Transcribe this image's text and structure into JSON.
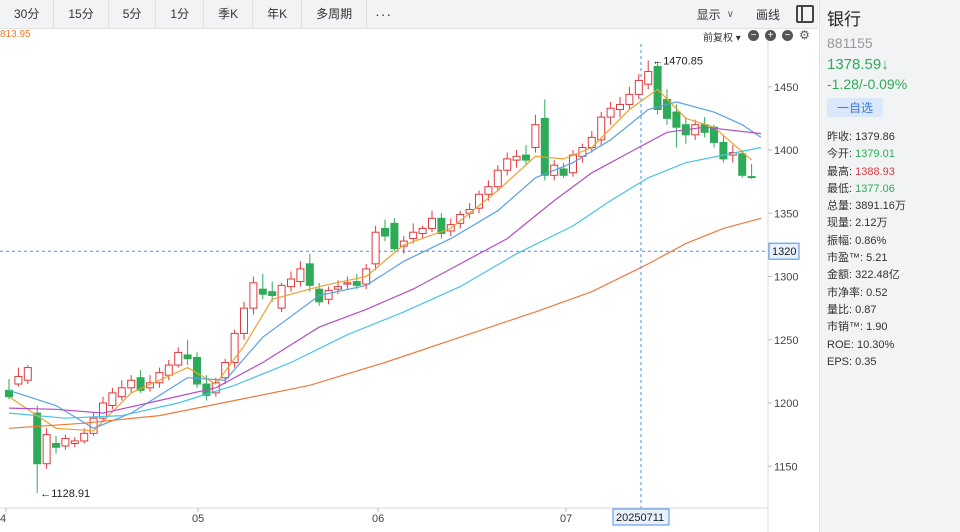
{
  "toolbar": {
    "periods": [
      "30分",
      "15分",
      "5分",
      "1分",
      "季K",
      "年K",
      "多周期"
    ],
    "more_label": "···",
    "display_label": "显示",
    "draw_label": "画线"
  },
  "subbar": {
    "ma_value": "813.95",
    "adjust_label": "前复权"
  },
  "stock": {
    "name": "银行",
    "code": "881155",
    "price": "1378.59↓",
    "change": "-1.28/-0.09%",
    "watch_label": "一自选"
  },
  "quotes": [
    {
      "label": "昨收:",
      "value": "1379.86",
      "tone": "normal"
    },
    {
      "label": "今开:",
      "value": "1379.01",
      "tone": "green"
    },
    {
      "label": "最高:",
      "value": "1388.93",
      "tone": "red"
    },
    {
      "label": "最低:",
      "value": "1377.06",
      "tone": "green"
    },
    {
      "label": "总量:",
      "value": "3891.16万",
      "tone": "normal"
    },
    {
      "label": "现量:",
      "value": "2.12万",
      "tone": "normal"
    },
    {
      "label": "振幅:",
      "value": "0.86%",
      "tone": "normal"
    },
    {
      "label": "市盈™:",
      "value": "5.21",
      "tone": "normal"
    },
    {
      "label": "金额:",
      "value": "322.48亿",
      "tone": "normal"
    },
    {
      "label": "市净率:",
      "value": "0.52",
      "tone": "normal"
    },
    {
      "label": "量比:",
      "value": "0.87",
      "tone": "normal"
    },
    {
      "label": "市销™:",
      "value": "1.90",
      "tone": "normal"
    },
    {
      "label": "ROE:",
      "value": "10.30%",
      "tone": "normal"
    },
    {
      "label": "EPS:",
      "value": "0.35",
      "tone": "normal"
    }
  ],
  "colors": {
    "up": "#e0393e",
    "down": "#2eab58",
    "ma5": "#f0a030",
    "ma10": "#5aa0e6",
    "ma20": "#b44fc2",
    "ma30": "#48c4e6",
    "ma60": "#f07a3e"
  },
  "chart_data": {
    "type": "candlestick",
    "y_ticks": [
      1150,
      1200,
      1250,
      1300,
      1350,
      1400,
      1450
    ],
    "x_ticks": [
      "4",
      "05",
      "06",
      "07"
    ],
    "crosshair": {
      "price": "1320",
      "date": "20250711"
    },
    "annotations": [
      {
        "text": "←1470.85",
        "value": 1470.85
      },
      {
        "text": "←1128.91",
        "value": 1128.91
      }
    ],
    "candles": [
      {
        "o": 1210,
        "h": 1219,
        "c": 1205,
        "l": 1203
      },
      {
        "o": 1215,
        "h": 1228,
        "c": 1221,
        "l": 1213
      },
      {
        "o": 1218,
        "h": 1230,
        "c": 1228,
        "l": 1215
      },
      {
        "o": 1192,
        "h": 1198,
        "c": 1152,
        "l": 1128.91
      },
      {
        "o": 1152,
        "h": 1180,
        "c": 1175,
        "l": 1148
      },
      {
        "o": 1168,
        "h": 1174,
        "c": 1165,
        "l": 1160
      },
      {
        "o": 1166,
        "h": 1175,
        "c": 1172,
        "l": 1163
      },
      {
        "o": 1168,
        "h": 1173,
        "c": 1170,
        "l": 1165
      },
      {
        "o": 1170,
        "h": 1180,
        "c": 1176,
        "l": 1168
      },
      {
        "o": 1176,
        "h": 1192,
        "c": 1188,
        "l": 1174
      },
      {
        "o": 1188,
        "h": 1205,
        "c": 1200,
        "l": 1186
      },
      {
        "o": 1198,
        "h": 1212,
        "c": 1208,
        "l": 1195
      },
      {
        "o": 1205,
        "h": 1218,
        "c": 1212,
        "l": 1202
      },
      {
        "o": 1212,
        "h": 1222,
        "c": 1218,
        "l": 1208
      },
      {
        "o": 1220,
        "h": 1226,
        "c": 1210,
        "l": 1208
      },
      {
        "o": 1212,
        "h": 1222,
        "c": 1216,
        "l": 1209
      },
      {
        "o": 1216,
        "h": 1228,
        "c": 1224,
        "l": 1212
      },
      {
        "o": 1222,
        "h": 1234,
        "c": 1230,
        "l": 1218
      },
      {
        "o": 1230,
        "h": 1244,
        "c": 1240,
        "l": 1228
      },
      {
        "o": 1238,
        "h": 1250,
        "c": 1235,
        "l": 1230
      },
      {
        "o": 1236,
        "h": 1240,
        "c": 1215,
        "l": 1212
      },
      {
        "o": 1215,
        "h": 1222,
        "c": 1206,
        "l": 1202
      },
      {
        "o": 1208,
        "h": 1220,
        "c": 1216,
        "l": 1205
      },
      {
        "o": 1220,
        "h": 1235,
        "c": 1232,
        "l": 1215
      },
      {
        "o": 1232,
        "h": 1258,
        "c": 1255,
        "l": 1228
      },
      {
        "o": 1255,
        "h": 1280,
        "c": 1275,
        "l": 1250
      },
      {
        "o": 1275,
        "h": 1300,
        "c": 1295,
        "l": 1270
      },
      {
        "o": 1290,
        "h": 1302,
        "c": 1286,
        "l": 1282
      },
      {
        "o": 1288,
        "h": 1296,
        "c": 1285,
        "l": 1280
      },
      {
        "o": 1275,
        "h": 1295,
        "c": 1293,
        "l": 1272
      },
      {
        "o": 1292,
        "h": 1304,
        "c": 1298,
        "l": 1288
      },
      {
        "o": 1296,
        "h": 1312,
        "c": 1306,
        "l": 1292
      },
      {
        "o": 1310,
        "h": 1318,
        "c": 1293,
        "l": 1288
      },
      {
        "o": 1290,
        "h": 1295,
        "c": 1280,
        "l": 1277
      },
      {
        "o": 1282,
        "h": 1292,
        "c": 1289,
        "l": 1278
      },
      {
        "o": 1290,
        "h": 1297,
        "c": 1292,
        "l": 1286
      },
      {
        "o": 1294,
        "h": 1300,
        "c": 1295,
        "l": 1290
      },
      {
        "o": 1296,
        "h": 1302,
        "c": 1293,
        "l": 1290
      },
      {
        "o": 1294,
        "h": 1310,
        "c": 1306,
        "l": 1290
      },
      {
        "o": 1310,
        "h": 1340,
        "c": 1335,
        "l": 1305
      },
      {
        "o": 1338,
        "h": 1345,
        "c": 1332,
        "l": 1328
      },
      {
        "o": 1342,
        "h": 1346,
        "c": 1322,
        "l": 1320
      },
      {
        "o": 1324,
        "h": 1332,
        "c": 1328,
        "l": 1318
      },
      {
        "o": 1330,
        "h": 1342,
        "c": 1335,
        "l": 1326
      },
      {
        "o": 1334,
        "h": 1340,
        "c": 1338,
        "l": 1330
      },
      {
        "o": 1338,
        "h": 1352,
        "c": 1346,
        "l": 1335
      },
      {
        "o": 1346,
        "h": 1350,
        "c": 1334,
        "l": 1330
      },
      {
        "o": 1336,
        "h": 1346,
        "c": 1341,
        "l": 1332
      },
      {
        "o": 1342,
        "h": 1352,
        "c": 1349,
        "l": 1338
      },
      {
        "o": 1350,
        "h": 1358,
        "c": 1353,
        "l": 1346
      },
      {
        "o": 1354,
        "h": 1368,
        "c": 1365,
        "l": 1350
      },
      {
        "o": 1365,
        "h": 1376,
        "c": 1371,
        "l": 1360
      },
      {
        "o": 1371,
        "h": 1388,
        "c": 1384,
        "l": 1368
      },
      {
        "o": 1384,
        "h": 1398,
        "c": 1393,
        "l": 1380
      },
      {
        "o": 1392,
        "h": 1400,
        "c": 1395,
        "l": 1386
      },
      {
        "o": 1396,
        "h": 1404,
        "c": 1392,
        "l": 1388
      },
      {
        "o": 1402,
        "h": 1428,
        "c": 1420,
        "l": 1398
      },
      {
        "o": 1425,
        "h": 1440,
        "c": 1380,
        "l": 1376
      },
      {
        "o": 1380,
        "h": 1392,
        "c": 1388,
        "l": 1376
      },
      {
        "o": 1385,
        "h": 1390,
        "c": 1380,
        "l": 1378
      },
      {
        "o": 1382,
        "h": 1400,
        "c": 1396,
        "l": 1379
      },
      {
        "o": 1395,
        "h": 1405,
        "c": 1402,
        "l": 1390
      },
      {
        "o": 1402,
        "h": 1415,
        "c": 1410,
        "l": 1398
      },
      {
        "o": 1408,
        "h": 1430,
        "c": 1426,
        "l": 1404
      },
      {
        "o": 1426,
        "h": 1438,
        "c": 1433,
        "l": 1420
      },
      {
        "o": 1432,
        "h": 1442,
        "c": 1436,
        "l": 1426
      },
      {
        "o": 1436,
        "h": 1450,
        "c": 1444,
        "l": 1432
      },
      {
        "o": 1444,
        "h": 1460,
        "c": 1455,
        "l": 1440
      },
      {
        "o": 1452,
        "h": 1470.85,
        "c": 1462,
        "l": 1448
      },
      {
        "o": 1466,
        "h": 1470,
        "c": 1432,
        "l": 1428
      },
      {
        "o": 1440,
        "h": 1448,
        "c": 1425,
        "l": 1420
      },
      {
        "o": 1430,
        "h": 1436,
        "c": 1418,
        "l": 1402
      },
      {
        "o": 1420,
        "h": 1426,
        "c": 1412,
        "l": 1405
      },
      {
        "o": 1412,
        "h": 1424,
        "c": 1420,
        "l": 1408
      },
      {
        "o": 1420,
        "h": 1426,
        "c": 1414,
        "l": 1410
      },
      {
        "o": 1418,
        "h": 1420,
        "c": 1406,
        "l": 1402
      },
      {
        "o": 1406,
        "h": 1412,
        "c": 1393,
        "l": 1390
      },
      {
        "o": 1396,
        "h": 1404,
        "c": 1398,
        "l": 1390
      },
      {
        "o": 1397,
        "h": 1400,
        "c": 1380,
        "l": 1378
      },
      {
        "o": 1379.01,
        "h": 1388.93,
        "c": 1378.59,
        "l": 1377.06
      }
    ],
    "ma_lines": [
      {
        "key": "ma5",
        "points": [
          [
            0,
            1205
          ],
          [
            5,
            1180
          ],
          [
            9,
            1178
          ],
          [
            13,
            1208
          ],
          [
            19,
            1228
          ],
          [
            22,
            1215
          ],
          [
            25,
            1245
          ],
          [
            28,
            1282
          ],
          [
            33,
            1292
          ],
          [
            38,
            1300
          ],
          [
            42,
            1325
          ],
          [
            47,
            1338
          ],
          [
            52,
            1368
          ],
          [
            56,
            1395
          ],
          [
            59,
            1393
          ],
          [
            62,
            1402
          ],
          [
            66,
            1432
          ],
          [
            69,
            1448
          ],
          [
            72,
            1425
          ],
          [
            75,
            1418
          ],
          [
            79,
            1392
          ]
        ]
      },
      {
        "key": "ma10",
        "points": [
          [
            0,
            1210
          ],
          [
            5,
            1198
          ],
          [
            9,
            1180
          ],
          [
            13,
            1192
          ],
          [
            19,
            1220
          ],
          [
            23,
            1218
          ],
          [
            27,
            1252
          ],
          [
            33,
            1285
          ],
          [
            38,
            1293
          ],
          [
            42,
            1312
          ],
          [
            47,
            1330
          ],
          [
            52,
            1352
          ],
          [
            56,
            1378
          ],
          [
            60,
            1390
          ],
          [
            64,
            1408
          ],
          [
            68,
            1432
          ],
          [
            71,
            1438
          ],
          [
            75,
            1430
          ],
          [
            78,
            1420
          ],
          [
            80,
            1410
          ]
        ]
      },
      {
        "key": "ma20",
        "points": [
          [
            0,
            1196
          ],
          [
            5,
            1195
          ],
          [
            10,
            1192
          ],
          [
            16,
            1202
          ],
          [
            22,
            1212
          ],
          [
            27,
            1232
          ],
          [
            33,
            1260
          ],
          [
            38,
            1274
          ],
          [
            43,
            1290
          ],
          [
            48,
            1310
          ],
          [
            53,
            1330
          ],
          [
            58,
            1360
          ],
          [
            62,
            1382
          ],
          [
            66,
            1398
          ],
          [
            70,
            1414
          ],
          [
            74,
            1418
          ],
          [
            80,
            1413
          ]
        ]
      },
      {
        "key": "ma30",
        "points": [
          [
            0,
            1192
          ],
          [
            6,
            1188
          ],
          [
            12,
            1190
          ],
          [
            18,
            1200
          ],
          [
            24,
            1214
          ],
          [
            30,
            1232
          ],
          [
            36,
            1254
          ],
          [
            42,
            1272
          ],
          [
            48,
            1292
          ],
          [
            54,
            1318
          ],
          [
            60,
            1340
          ],
          [
            64,
            1360
          ],
          [
            68,
            1378
          ],
          [
            72,
            1390
          ],
          [
            76,
            1396
          ],
          [
            80,
            1402
          ]
        ]
      },
      {
        "key": "ma60",
        "points": [
          [
            0,
            1180
          ],
          [
            8,
            1184
          ],
          [
            16,
            1190
          ],
          [
            24,
            1202
          ],
          [
            32,
            1214
          ],
          [
            40,
            1232
          ],
          [
            48,
            1252
          ],
          [
            56,
            1272
          ],
          [
            62,
            1288
          ],
          [
            68,
            1310
          ],
          [
            72,
            1326
          ],
          [
            76,
            1338
          ],
          [
            80,
            1346
          ]
        ]
      }
    ]
  }
}
